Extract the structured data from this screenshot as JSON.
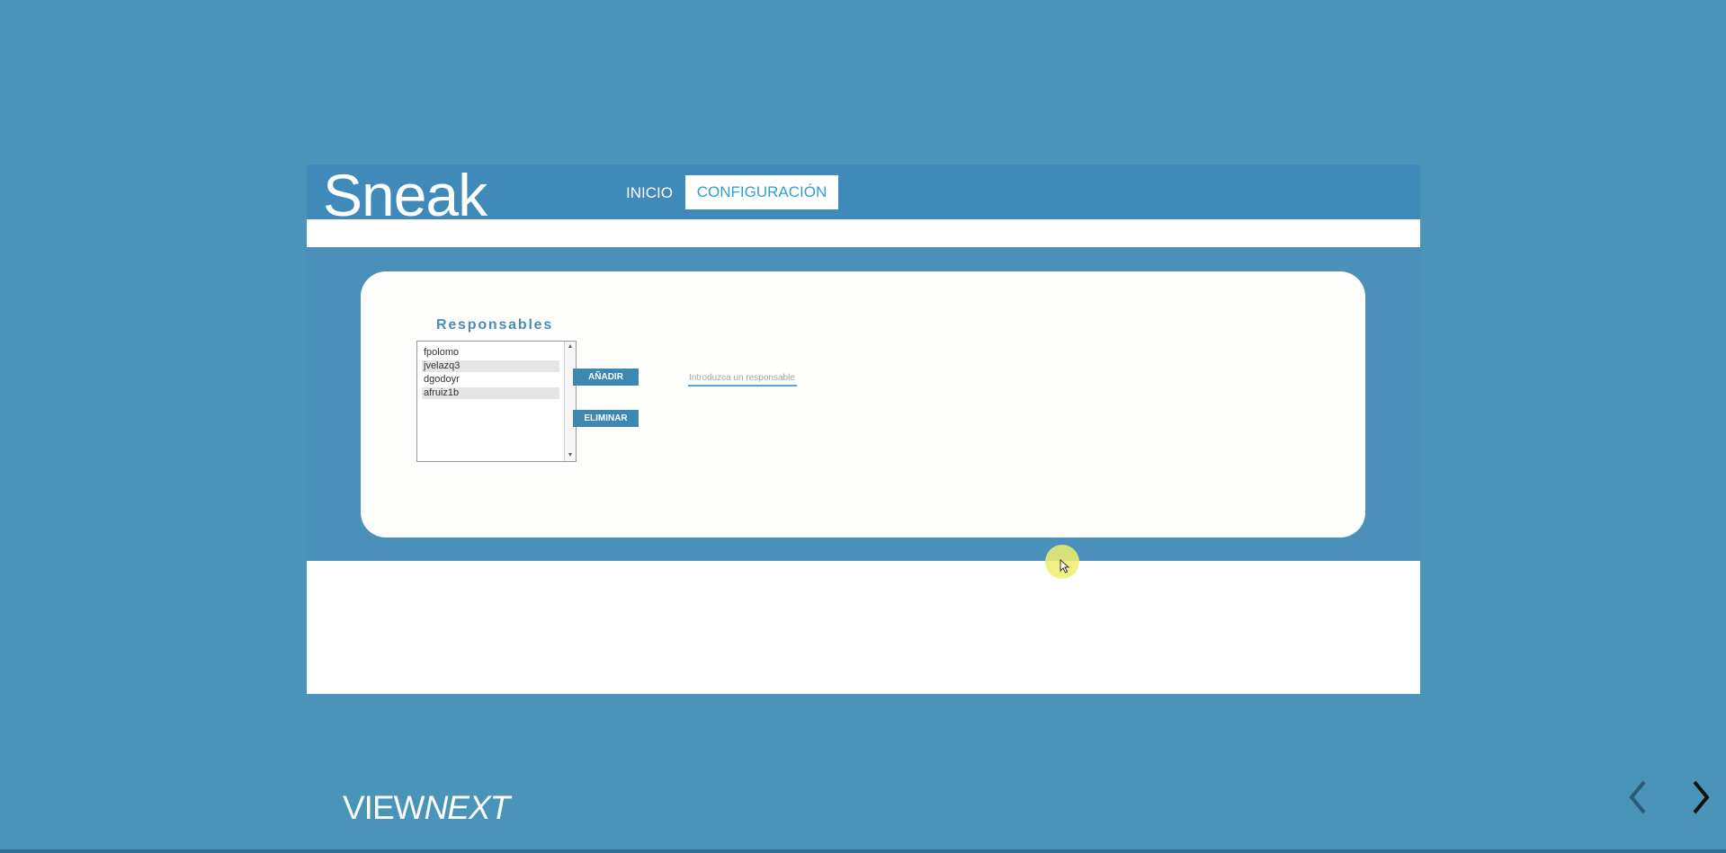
{
  "app": {
    "logo": "Sneak",
    "nav": {
      "inicio": "INICIO",
      "configuracion": "CONFIGURACIÓN"
    }
  },
  "responsables": {
    "title": "Responsables",
    "items": [
      "fpolomo",
      "jvelazq3",
      "dgodoyr",
      "afruiz1b"
    ],
    "add_button": "AÑADIR",
    "remove_button": "ELIMINAR",
    "input_placeholder": "Introduzca un responsable."
  },
  "footer": {
    "brand_plain": "VIEW",
    "brand_italic": "NEXT"
  },
  "colors": {
    "background": "#4a94b9",
    "header": "#3f8ab8",
    "accent_text": "#2d9fd1"
  },
  "icons": {
    "prev": "chevron-left-icon",
    "next": "chevron-right-icon",
    "cursor": "mouse-pointer-icon"
  }
}
